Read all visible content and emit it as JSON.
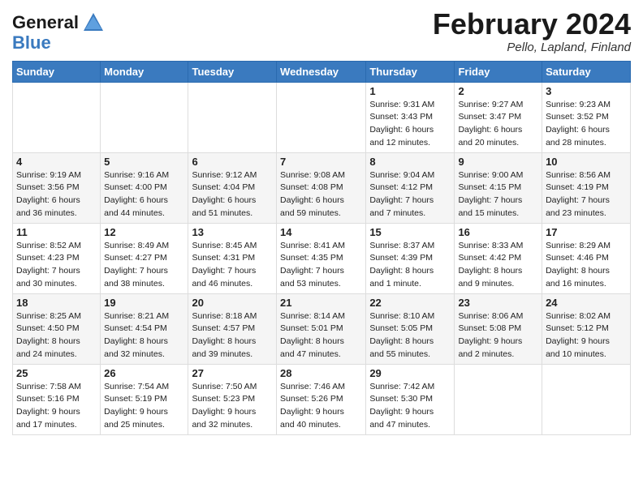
{
  "header": {
    "logo_general": "General",
    "logo_blue": "Blue",
    "month_title": "February 2024",
    "location": "Pello, Lapland, Finland"
  },
  "weekdays": [
    "Sunday",
    "Monday",
    "Tuesday",
    "Wednesday",
    "Thursday",
    "Friday",
    "Saturday"
  ],
  "weeks": [
    [
      {
        "day": "",
        "info": ""
      },
      {
        "day": "",
        "info": ""
      },
      {
        "day": "",
        "info": ""
      },
      {
        "day": "",
        "info": ""
      },
      {
        "day": "1",
        "info": "Sunrise: 9:31 AM\nSunset: 3:43 PM\nDaylight: 6 hours\nand 12 minutes."
      },
      {
        "day": "2",
        "info": "Sunrise: 9:27 AM\nSunset: 3:47 PM\nDaylight: 6 hours\nand 20 minutes."
      },
      {
        "day": "3",
        "info": "Sunrise: 9:23 AM\nSunset: 3:52 PM\nDaylight: 6 hours\nand 28 minutes."
      }
    ],
    [
      {
        "day": "4",
        "info": "Sunrise: 9:19 AM\nSunset: 3:56 PM\nDaylight: 6 hours\nand 36 minutes."
      },
      {
        "day": "5",
        "info": "Sunrise: 9:16 AM\nSunset: 4:00 PM\nDaylight: 6 hours\nand 44 minutes."
      },
      {
        "day": "6",
        "info": "Sunrise: 9:12 AM\nSunset: 4:04 PM\nDaylight: 6 hours\nand 51 minutes."
      },
      {
        "day": "7",
        "info": "Sunrise: 9:08 AM\nSunset: 4:08 PM\nDaylight: 6 hours\nand 59 minutes."
      },
      {
        "day": "8",
        "info": "Sunrise: 9:04 AM\nSunset: 4:12 PM\nDaylight: 7 hours\nand 7 minutes."
      },
      {
        "day": "9",
        "info": "Sunrise: 9:00 AM\nSunset: 4:15 PM\nDaylight: 7 hours\nand 15 minutes."
      },
      {
        "day": "10",
        "info": "Sunrise: 8:56 AM\nSunset: 4:19 PM\nDaylight: 7 hours\nand 23 minutes."
      }
    ],
    [
      {
        "day": "11",
        "info": "Sunrise: 8:52 AM\nSunset: 4:23 PM\nDaylight: 7 hours\nand 30 minutes."
      },
      {
        "day": "12",
        "info": "Sunrise: 8:49 AM\nSunset: 4:27 PM\nDaylight: 7 hours\nand 38 minutes."
      },
      {
        "day": "13",
        "info": "Sunrise: 8:45 AM\nSunset: 4:31 PM\nDaylight: 7 hours\nand 46 minutes."
      },
      {
        "day": "14",
        "info": "Sunrise: 8:41 AM\nSunset: 4:35 PM\nDaylight: 7 hours\nand 53 minutes."
      },
      {
        "day": "15",
        "info": "Sunrise: 8:37 AM\nSunset: 4:39 PM\nDaylight: 8 hours\nand 1 minute."
      },
      {
        "day": "16",
        "info": "Sunrise: 8:33 AM\nSunset: 4:42 PM\nDaylight: 8 hours\nand 9 minutes."
      },
      {
        "day": "17",
        "info": "Sunrise: 8:29 AM\nSunset: 4:46 PM\nDaylight: 8 hours\nand 16 minutes."
      }
    ],
    [
      {
        "day": "18",
        "info": "Sunrise: 8:25 AM\nSunset: 4:50 PM\nDaylight: 8 hours\nand 24 minutes."
      },
      {
        "day": "19",
        "info": "Sunrise: 8:21 AM\nSunset: 4:54 PM\nDaylight: 8 hours\nand 32 minutes."
      },
      {
        "day": "20",
        "info": "Sunrise: 8:18 AM\nSunset: 4:57 PM\nDaylight: 8 hours\nand 39 minutes."
      },
      {
        "day": "21",
        "info": "Sunrise: 8:14 AM\nSunset: 5:01 PM\nDaylight: 8 hours\nand 47 minutes."
      },
      {
        "day": "22",
        "info": "Sunrise: 8:10 AM\nSunset: 5:05 PM\nDaylight: 8 hours\nand 55 minutes."
      },
      {
        "day": "23",
        "info": "Sunrise: 8:06 AM\nSunset: 5:08 PM\nDaylight: 9 hours\nand 2 minutes."
      },
      {
        "day": "24",
        "info": "Sunrise: 8:02 AM\nSunset: 5:12 PM\nDaylight: 9 hours\nand 10 minutes."
      }
    ],
    [
      {
        "day": "25",
        "info": "Sunrise: 7:58 AM\nSunset: 5:16 PM\nDaylight: 9 hours\nand 17 minutes."
      },
      {
        "day": "26",
        "info": "Sunrise: 7:54 AM\nSunset: 5:19 PM\nDaylight: 9 hours\nand 25 minutes."
      },
      {
        "day": "27",
        "info": "Sunrise: 7:50 AM\nSunset: 5:23 PM\nDaylight: 9 hours\nand 32 minutes."
      },
      {
        "day": "28",
        "info": "Sunrise: 7:46 AM\nSunset: 5:26 PM\nDaylight: 9 hours\nand 40 minutes."
      },
      {
        "day": "29",
        "info": "Sunrise: 7:42 AM\nSunset: 5:30 PM\nDaylight: 9 hours\nand 47 minutes."
      },
      {
        "day": "",
        "info": ""
      },
      {
        "day": "",
        "info": ""
      }
    ]
  ]
}
